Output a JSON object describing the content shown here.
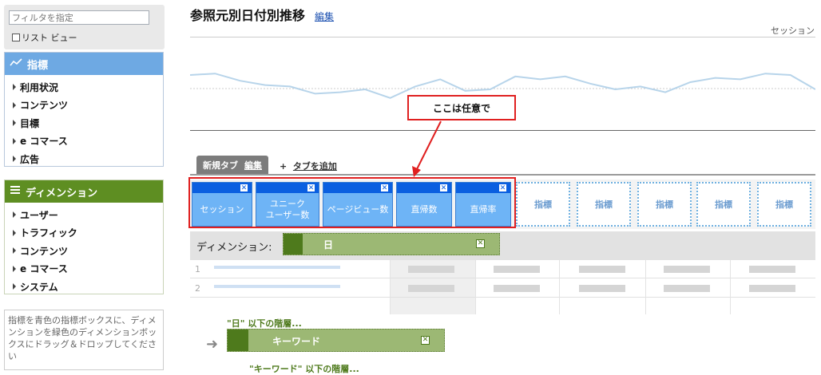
{
  "sidebar": {
    "filter_placeholder": "フィルタを指定",
    "list_view_label": "リスト ビュー",
    "metrics_title": "指標",
    "metrics_items": [
      "利用状況",
      "コンテンツ",
      "目標",
      "e コマース",
      "広告"
    ],
    "dimensions_title": "ディメンション",
    "dimension_items": [
      "ユーザー",
      "トラフィック",
      "コンテンツ",
      "e コマース",
      "システム"
    ],
    "help_text": "指標を青色の指標ボックスに、ディメンションを緑色のディメンションボックスにドラッグ＆ドロップしてください"
  },
  "header": {
    "title": "参照元別日付別推移",
    "edit_link": "編集",
    "series_label": "セッション"
  },
  "sparkline": {
    "values": [
      60,
      62,
      52,
      46,
      44,
      34,
      36,
      40,
      28,
      44,
      54,
      38,
      40,
      58,
      54,
      58,
      48,
      40,
      44,
      36,
      50,
      56,
      54,
      62,
      60,
      40
    ]
  },
  "tabs": {
    "active_tab": "新規タブ",
    "active_edit": "編集",
    "add_plus": "+",
    "add_tab": "タブを追加"
  },
  "metric_boxes": [
    "セッション",
    "ユニーク\nユーザー数",
    "ページビュー数",
    "直帰数",
    "直帰率"
  ],
  "metric_remove_glyph": "✕",
  "metric_slots": [
    "指標",
    "指標",
    "指標",
    "指標",
    "指標"
  ],
  "annotation": "ここは任意で",
  "dimension": {
    "label": "ディメンション:",
    "value": "日"
  },
  "table": {
    "rows": [
      "1",
      "2"
    ]
  },
  "hierarchy": {
    "level1_name": "\"日\"",
    "level1_suffix": "以下の階層...",
    "sub_dimension": "キーワード",
    "level2_name": "\"キーワード\"",
    "level2_suffix": "以下の階層..."
  },
  "colors": {
    "metric_blue": "#6eb4f6",
    "metric_dark_blue": "#0a5fe0",
    "dimension_green": "#5e8e22",
    "annotation_red": "#e02020"
  }
}
